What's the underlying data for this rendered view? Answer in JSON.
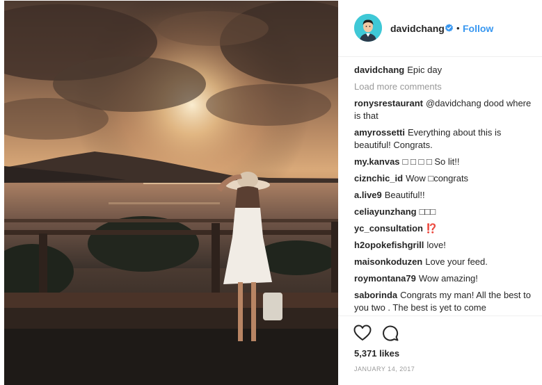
{
  "post": {
    "author": {
      "username": "davidchang",
      "verified": true,
      "dot": "•",
      "follow_label": "Follow"
    },
    "caption": {
      "username": "davidchang",
      "text": "Epic day"
    },
    "load_more_label": "Load more comments",
    "comments": [
      {
        "username": "ronysrestaurant",
        "text": "@davidchang dood where is that"
      },
      {
        "username": "amyrossetti",
        "text": "Everything about this is beautiful! Congrats."
      },
      {
        "username": "my.kanvas",
        "text": "□ □ □ □ So lit!!"
      },
      {
        "username": "ciznchic_id",
        "text": "Wow □congrats"
      },
      {
        "username": "a.live9",
        "text": "Beautiful!!"
      },
      {
        "username": "celiayunzhang",
        "text": "□□□"
      },
      {
        "username": "yc_consultation",
        "text": "⁉️"
      },
      {
        "username": "h2opokefishgrill",
        "text": "love!"
      },
      {
        "username": "maisonkoduzen",
        "text": "Love your feed."
      },
      {
        "username": "roymontana79",
        "text": "Wow amazing!"
      },
      {
        "username": "saborinda",
        "text": "Congrats my man! All the best to you two . The best is yet to come"
      }
    ],
    "likes": "5,371 likes",
    "date": "JANUARY 14, 2017"
  },
  "icons": {
    "verified": "verified-badge-icon",
    "like": "heart-icon",
    "comment": "comment-bubble-icon"
  },
  "colors": {
    "link": "#3897f0",
    "verified": "#3897f0",
    "muted": "#999999",
    "avatar_bg": "#3fc8d6"
  }
}
